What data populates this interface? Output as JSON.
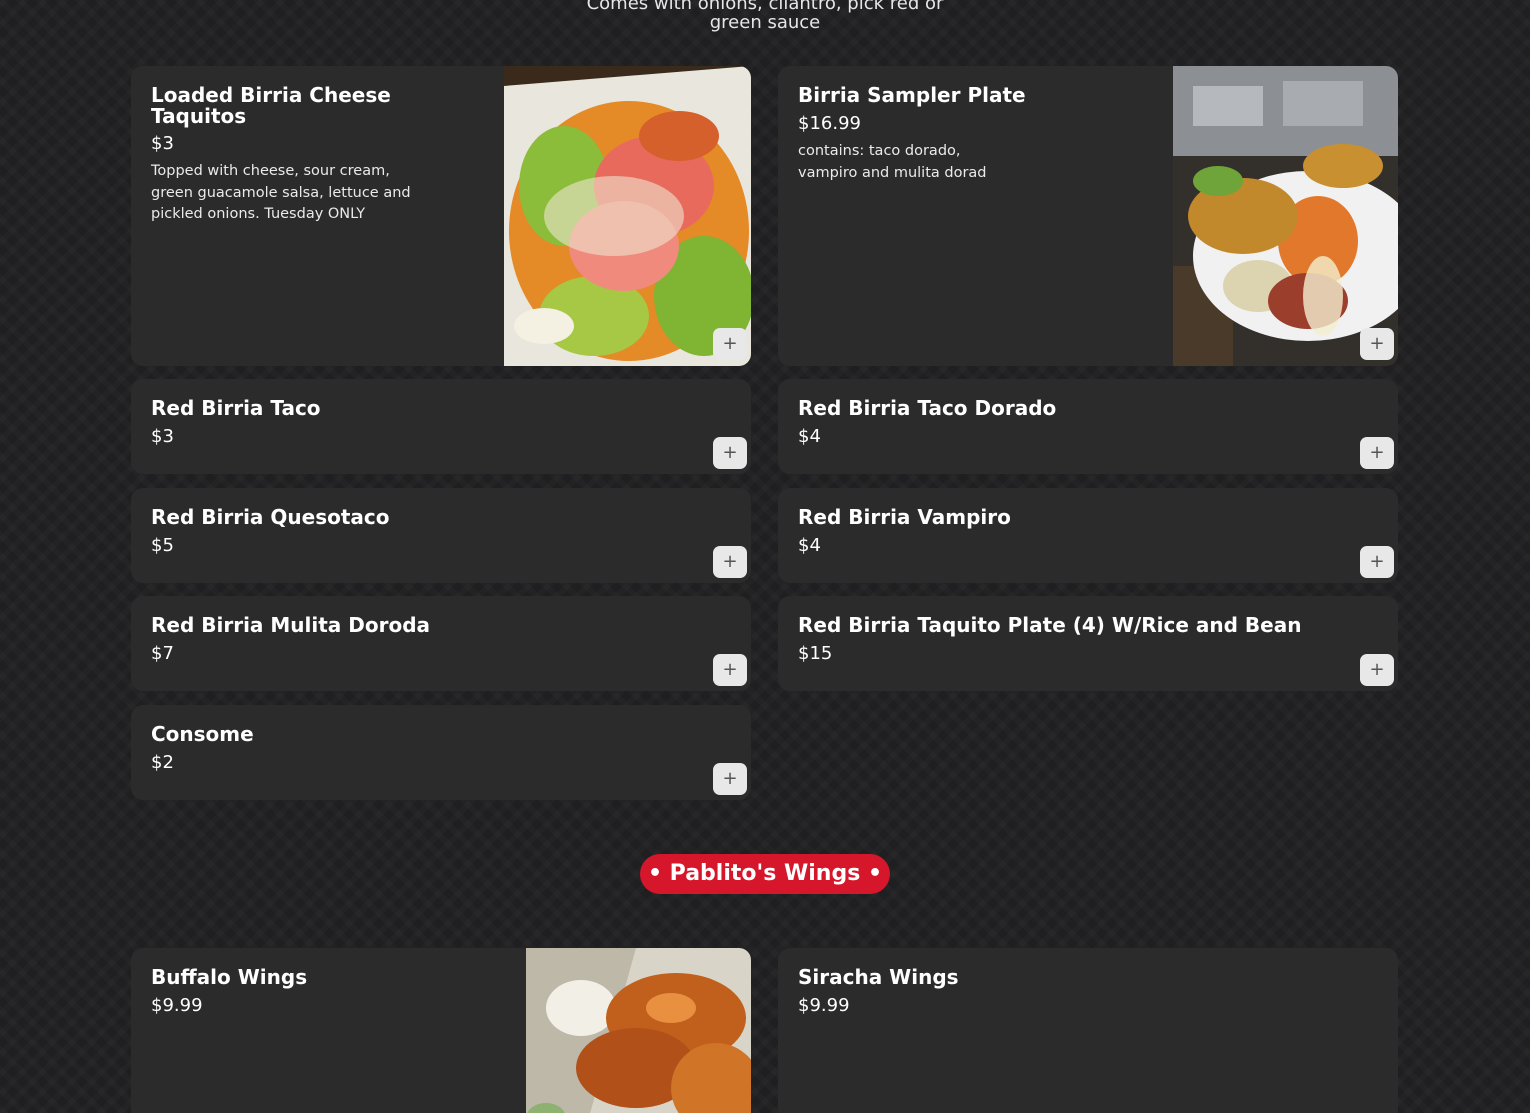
{
  "section": {
    "subtitle": "Comes with onions, cilantro, pick red or green sauce"
  },
  "items": [
    {
      "name": "Loaded Birria Cheese Taquitos",
      "price": "$3",
      "description": "Topped with cheese, sour cream, green guacamole salsa, lettuce and pickled onions. Tuesday ONLY",
      "add_label": "+"
    },
    {
      "name": "Birria Sampler Plate",
      "price": "$16.99",
      "description": "contains: taco dorado, vampiro and mulita dorad",
      "add_label": "+"
    },
    {
      "name": "Red Birria Taco",
      "price": "$3",
      "add_label": "+"
    },
    {
      "name": "Red Birria Taco Dorado",
      "price": "$4",
      "add_label": "+"
    },
    {
      "name": "Red Birria Quesotaco",
      "price": "$5",
      "add_label": "+"
    },
    {
      "name": "Red Birria Vampiro",
      "price": "$4",
      "add_label": "+"
    },
    {
      "name": "Red Birria Mulita Doroda",
      "price": "$7",
      "add_label": "+"
    },
    {
      "name": "Red Birria Taquito Plate (4) W/Rice and Bean",
      "price": "$15",
      "add_label": "+"
    },
    {
      "name": "Consome",
      "price": "$2",
      "add_label": "+"
    }
  ],
  "wings_category": {
    "label": "• Pablito's Wings •",
    "items": [
      {
        "name": "Buffalo Wings",
        "price": "$9.99"
      },
      {
        "name": "Siracha Wings",
        "price": "$9.99"
      }
    ]
  },
  "colors": {
    "background": "#1f1f21",
    "card": "#2b2b2b",
    "accent": "#d6162a",
    "add_button": "#e8e8e8"
  },
  "icons": {
    "add": "plus-icon"
  }
}
